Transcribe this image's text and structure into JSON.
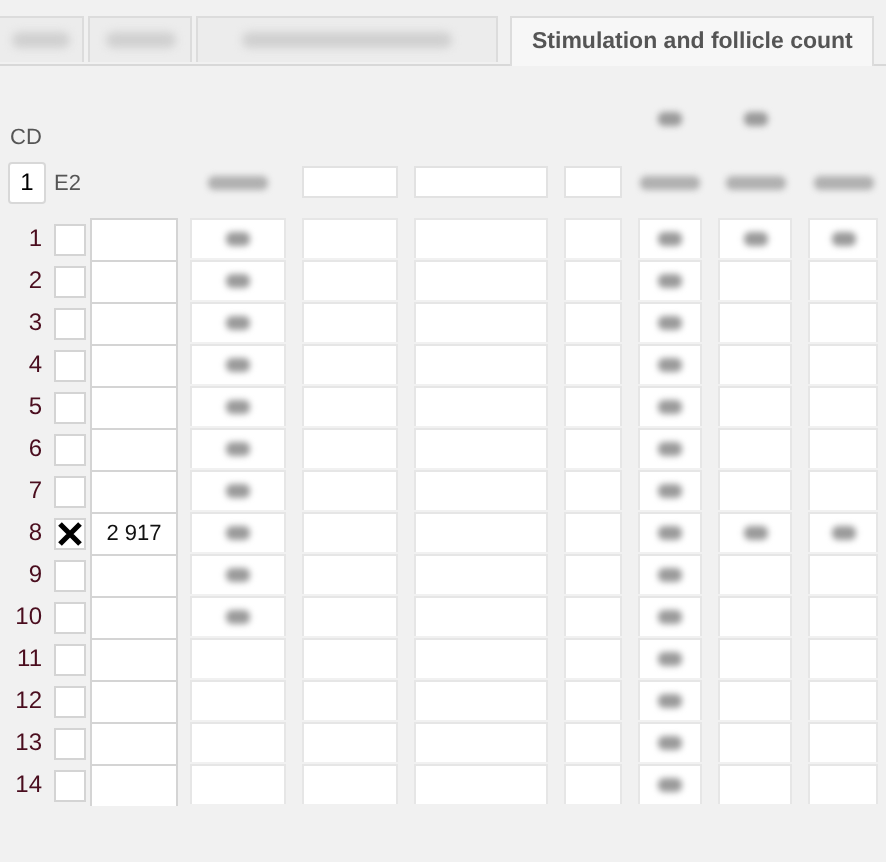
{
  "tabs": [
    {
      "selected": false
    },
    {
      "selected": false
    },
    {
      "selected": false
    },
    {
      "label": "Stimulation and follicle count",
      "selected": true
    }
  ],
  "cycle_day": {
    "label": "CD",
    "value": "1"
  },
  "e2_label": "E2",
  "top_header": [
    {
      "blurred": false
    },
    {
      "blurred": false
    },
    {
      "blurred": false
    },
    {
      "blurred": false
    },
    {
      "blurred": true
    },
    {
      "blurred": true
    },
    {
      "blurred": false
    }
  ],
  "header": [
    {
      "kind": "blurred"
    },
    {
      "kind": "field"
    },
    {
      "kind": "field"
    },
    {
      "kind": "field"
    },
    {
      "kind": "blurred"
    },
    {
      "kind": "blurred"
    },
    {
      "kind": "blurred"
    }
  ],
  "rows": [
    {
      "number": "1",
      "checked": false,
      "cells": [
        {
          "blurred": true
        },
        {
          "blurred": false
        },
        {
          "blurred": false
        },
        {
          "blurred": false
        },
        {
          "blurred": true
        },
        {
          "blurred": true
        },
        {
          "blurred": true
        }
      ]
    },
    {
      "number": "2",
      "checked": false,
      "cells": [
        {
          "blurred": true
        },
        {
          "blurred": false
        },
        {
          "blurred": false
        },
        {
          "blurred": false
        },
        {
          "blurred": true
        },
        {
          "blurred": false
        },
        {
          "blurred": false
        }
      ]
    },
    {
      "number": "3",
      "checked": false,
      "cells": [
        {
          "blurred": true
        },
        {
          "blurred": false
        },
        {
          "blurred": false
        },
        {
          "blurred": false
        },
        {
          "blurred": true
        },
        {
          "blurred": false
        },
        {
          "blurred": false
        }
      ]
    },
    {
      "number": "4",
      "checked": false,
      "cells": [
        {
          "blurred": true
        },
        {
          "blurred": false
        },
        {
          "blurred": false
        },
        {
          "blurred": false
        },
        {
          "blurred": true
        },
        {
          "blurred": false
        },
        {
          "blurred": false
        }
      ]
    },
    {
      "number": "5",
      "checked": false,
      "cells": [
        {
          "blurred": true
        },
        {
          "blurred": false
        },
        {
          "blurred": false
        },
        {
          "blurred": false
        },
        {
          "blurred": true
        },
        {
          "blurred": false
        },
        {
          "blurred": false
        }
      ]
    },
    {
      "number": "6",
      "checked": false,
      "cells": [
        {
          "blurred": true
        },
        {
          "blurred": false
        },
        {
          "blurred": false
        },
        {
          "blurred": false
        },
        {
          "blurred": true
        },
        {
          "blurred": false
        },
        {
          "blurred": false
        }
      ]
    },
    {
      "number": "7",
      "checked": false,
      "cells": [
        {
          "blurred": true
        },
        {
          "blurred": false
        },
        {
          "blurred": false
        },
        {
          "blurred": false
        },
        {
          "blurred": true
        },
        {
          "blurred": false
        },
        {
          "blurred": false
        }
      ]
    },
    {
      "number": "8",
      "checked": true,
      "e2": "2 917",
      "cells": [
        {
          "blurred": true
        },
        {
          "blurred": false
        },
        {
          "blurred": false
        },
        {
          "blurred": false
        },
        {
          "blurred": true
        },
        {
          "blurred": true
        },
        {
          "blurred": true
        }
      ]
    },
    {
      "number": "9",
      "checked": false,
      "cells": [
        {
          "blurred": true
        },
        {
          "blurred": false
        },
        {
          "blurred": false
        },
        {
          "blurred": false
        },
        {
          "blurred": true
        },
        {
          "blurred": false
        },
        {
          "blurred": false
        }
      ]
    },
    {
      "number": "10",
      "checked": false,
      "cells": [
        {
          "blurred": true
        },
        {
          "blurred": false
        },
        {
          "blurred": false
        },
        {
          "blurred": false
        },
        {
          "blurred": true
        },
        {
          "blurred": false
        },
        {
          "blurred": false
        }
      ]
    },
    {
      "number": "11",
      "checked": false,
      "cells": [
        {
          "blurred": false
        },
        {
          "blurred": false
        },
        {
          "blurred": false
        },
        {
          "blurred": false
        },
        {
          "blurred": true
        },
        {
          "blurred": false
        },
        {
          "blurred": false
        }
      ]
    },
    {
      "number": "12",
      "checked": false,
      "cells": [
        {
          "blurred": false
        },
        {
          "blurred": false
        },
        {
          "blurred": false
        },
        {
          "blurred": false
        },
        {
          "blurred": true
        },
        {
          "blurred": false
        },
        {
          "blurred": false
        }
      ]
    },
    {
      "number": "13",
      "checked": false,
      "cells": [
        {
          "blurred": false
        },
        {
          "blurred": false
        },
        {
          "blurred": false
        },
        {
          "blurred": false
        },
        {
          "blurred": true
        },
        {
          "blurred": false
        },
        {
          "blurred": false
        }
      ]
    },
    {
      "number": "14",
      "checked": false,
      "cells": [
        {
          "blurred": false
        },
        {
          "blurred": false
        },
        {
          "blurred": false
        },
        {
          "blurred": false
        },
        {
          "blurred": true
        },
        {
          "blurred": false
        },
        {
          "blurred": false
        }
      ]
    }
  ]
}
